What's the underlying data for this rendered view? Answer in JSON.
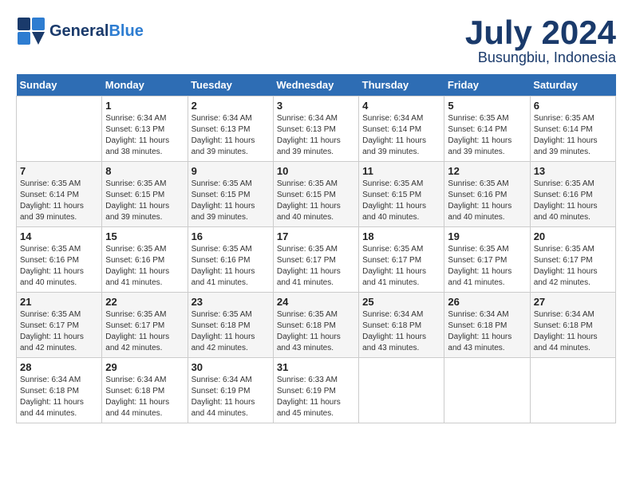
{
  "header": {
    "logo_general": "General",
    "logo_blue": "Blue",
    "month": "July 2024",
    "location": "Busungbiu, Indonesia"
  },
  "days_of_week": [
    "Sunday",
    "Monday",
    "Tuesday",
    "Wednesday",
    "Thursday",
    "Friday",
    "Saturday"
  ],
  "weeks": [
    [
      {
        "day": "",
        "info": ""
      },
      {
        "day": "1",
        "info": "Sunrise: 6:34 AM\nSunset: 6:13 PM\nDaylight: 11 hours\nand 38 minutes."
      },
      {
        "day": "2",
        "info": "Sunrise: 6:34 AM\nSunset: 6:13 PM\nDaylight: 11 hours\nand 39 minutes."
      },
      {
        "day": "3",
        "info": "Sunrise: 6:34 AM\nSunset: 6:13 PM\nDaylight: 11 hours\nand 39 minutes."
      },
      {
        "day": "4",
        "info": "Sunrise: 6:34 AM\nSunset: 6:14 PM\nDaylight: 11 hours\nand 39 minutes."
      },
      {
        "day": "5",
        "info": "Sunrise: 6:35 AM\nSunset: 6:14 PM\nDaylight: 11 hours\nand 39 minutes."
      },
      {
        "day": "6",
        "info": "Sunrise: 6:35 AM\nSunset: 6:14 PM\nDaylight: 11 hours\nand 39 minutes."
      }
    ],
    [
      {
        "day": "7",
        "info": "Sunrise: 6:35 AM\nSunset: 6:14 PM\nDaylight: 11 hours\nand 39 minutes."
      },
      {
        "day": "8",
        "info": "Sunrise: 6:35 AM\nSunset: 6:15 PM\nDaylight: 11 hours\nand 39 minutes."
      },
      {
        "day": "9",
        "info": "Sunrise: 6:35 AM\nSunset: 6:15 PM\nDaylight: 11 hours\nand 39 minutes."
      },
      {
        "day": "10",
        "info": "Sunrise: 6:35 AM\nSunset: 6:15 PM\nDaylight: 11 hours\nand 40 minutes."
      },
      {
        "day": "11",
        "info": "Sunrise: 6:35 AM\nSunset: 6:15 PM\nDaylight: 11 hours\nand 40 minutes."
      },
      {
        "day": "12",
        "info": "Sunrise: 6:35 AM\nSunset: 6:16 PM\nDaylight: 11 hours\nand 40 minutes."
      },
      {
        "day": "13",
        "info": "Sunrise: 6:35 AM\nSunset: 6:16 PM\nDaylight: 11 hours\nand 40 minutes."
      }
    ],
    [
      {
        "day": "14",
        "info": "Sunrise: 6:35 AM\nSunset: 6:16 PM\nDaylight: 11 hours\nand 40 minutes."
      },
      {
        "day": "15",
        "info": "Sunrise: 6:35 AM\nSunset: 6:16 PM\nDaylight: 11 hours\nand 41 minutes."
      },
      {
        "day": "16",
        "info": "Sunrise: 6:35 AM\nSunset: 6:16 PM\nDaylight: 11 hours\nand 41 minutes."
      },
      {
        "day": "17",
        "info": "Sunrise: 6:35 AM\nSunset: 6:17 PM\nDaylight: 11 hours\nand 41 minutes."
      },
      {
        "day": "18",
        "info": "Sunrise: 6:35 AM\nSunset: 6:17 PM\nDaylight: 11 hours\nand 41 minutes."
      },
      {
        "day": "19",
        "info": "Sunrise: 6:35 AM\nSunset: 6:17 PM\nDaylight: 11 hours\nand 41 minutes."
      },
      {
        "day": "20",
        "info": "Sunrise: 6:35 AM\nSunset: 6:17 PM\nDaylight: 11 hours\nand 42 minutes."
      }
    ],
    [
      {
        "day": "21",
        "info": "Sunrise: 6:35 AM\nSunset: 6:17 PM\nDaylight: 11 hours\nand 42 minutes."
      },
      {
        "day": "22",
        "info": "Sunrise: 6:35 AM\nSunset: 6:17 PM\nDaylight: 11 hours\nand 42 minutes."
      },
      {
        "day": "23",
        "info": "Sunrise: 6:35 AM\nSunset: 6:18 PM\nDaylight: 11 hours\nand 42 minutes."
      },
      {
        "day": "24",
        "info": "Sunrise: 6:35 AM\nSunset: 6:18 PM\nDaylight: 11 hours\nand 43 minutes."
      },
      {
        "day": "25",
        "info": "Sunrise: 6:34 AM\nSunset: 6:18 PM\nDaylight: 11 hours\nand 43 minutes."
      },
      {
        "day": "26",
        "info": "Sunrise: 6:34 AM\nSunset: 6:18 PM\nDaylight: 11 hours\nand 43 minutes."
      },
      {
        "day": "27",
        "info": "Sunrise: 6:34 AM\nSunset: 6:18 PM\nDaylight: 11 hours\nand 44 minutes."
      }
    ],
    [
      {
        "day": "28",
        "info": "Sunrise: 6:34 AM\nSunset: 6:18 PM\nDaylight: 11 hours\nand 44 minutes."
      },
      {
        "day": "29",
        "info": "Sunrise: 6:34 AM\nSunset: 6:18 PM\nDaylight: 11 hours\nand 44 minutes."
      },
      {
        "day": "30",
        "info": "Sunrise: 6:34 AM\nSunset: 6:19 PM\nDaylight: 11 hours\nand 44 minutes."
      },
      {
        "day": "31",
        "info": "Sunrise: 6:33 AM\nSunset: 6:19 PM\nDaylight: 11 hours\nand 45 minutes."
      },
      {
        "day": "",
        "info": ""
      },
      {
        "day": "",
        "info": ""
      },
      {
        "day": "",
        "info": ""
      }
    ]
  ]
}
